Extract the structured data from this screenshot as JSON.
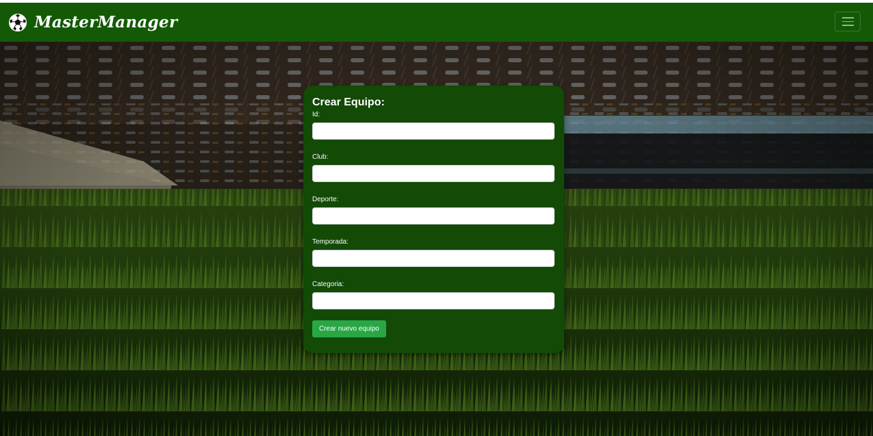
{
  "navbar": {
    "brand": "MasterManager",
    "brand_icon": "soccer-ball-icon",
    "toggler_icon": "hamburger-menu-icon",
    "background": "#145a06"
  },
  "form": {
    "title": "Crear Equipo:",
    "fields": [
      {
        "label": "Id:",
        "value": "",
        "placeholder": ""
      },
      {
        "label": "Club:",
        "value": "",
        "placeholder": ""
      },
      {
        "label": "Deporte:",
        "value": "",
        "placeholder": ""
      },
      {
        "label": "Temporada:",
        "value": "",
        "placeholder": ""
      },
      {
        "label": "Categoria:",
        "value": "",
        "placeholder": ""
      }
    ],
    "submit_label": "Crear nuevo equipo",
    "card_color": "#124a06",
    "button_color": "#28a745"
  },
  "background": {
    "description_icon": "stadium-grass-background"
  }
}
